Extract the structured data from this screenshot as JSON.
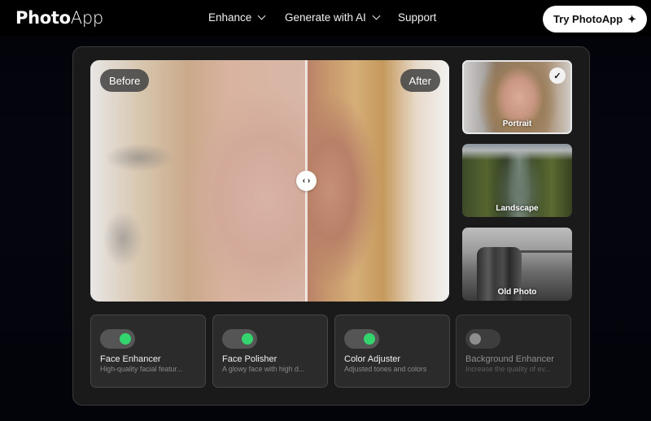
{
  "header": {
    "logo_bold": "Photo",
    "logo_light": "App",
    "nav": [
      {
        "label": "Enhance",
        "has_dropdown": true
      },
      {
        "label": "Generate with AI",
        "has_dropdown": true
      },
      {
        "label": "Support",
        "has_dropdown": false
      }
    ],
    "cta_label": "Try PhotoApp",
    "cta_icon": "sparkle-icon"
  },
  "compare": {
    "before_label": "Before",
    "after_label": "After",
    "handle_glyph": "‹ ›",
    "slider_position_percent": 60
  },
  "samples": [
    {
      "label": "Portrait",
      "selected": true,
      "check_glyph": "✓"
    },
    {
      "label": "Landscape",
      "selected": false
    },
    {
      "label": "Old Photo",
      "selected": false
    }
  ],
  "features": [
    {
      "title": "Face Enhancer",
      "description": "High-quality facial featur...",
      "enabled": true
    },
    {
      "title": "Face Polisher",
      "description": "A glowy face with high d...",
      "enabled": true
    },
    {
      "title": "Color Adjuster",
      "description": "Adjusted tones and colors",
      "enabled": true
    },
    {
      "title": "Background Enhancer",
      "description": "Increase the quality of ev...",
      "enabled": false
    }
  ],
  "colors": {
    "toggle_on": "#34d46e",
    "toggle_off_knob": "#8e8e8e",
    "panel_bg": "#1a1a1a",
    "cta_bg": "#ffffff"
  }
}
